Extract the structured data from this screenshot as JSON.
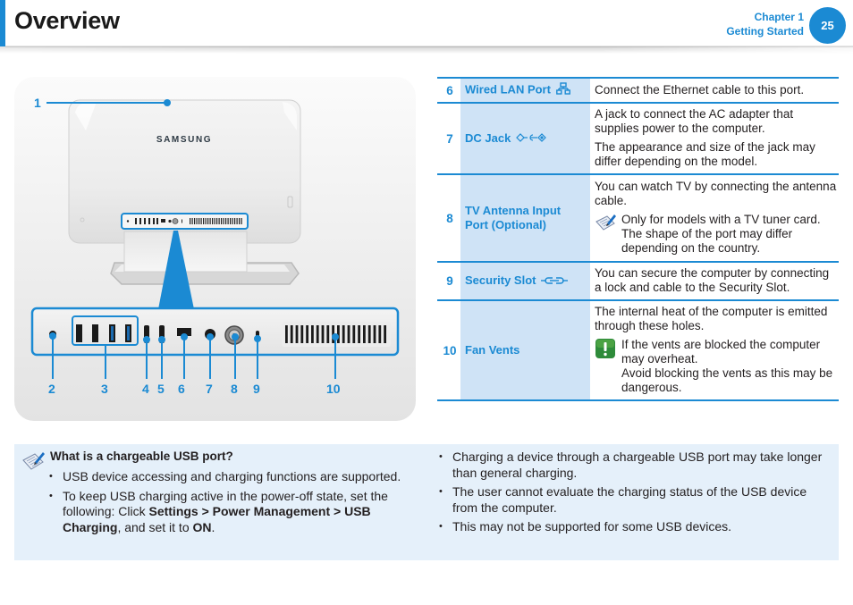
{
  "header": {
    "title": "Overview",
    "chapter_line1": "Chapter 1",
    "chapter_line2": "Getting Started",
    "page_number": "25",
    "accent_color": "#1b8ad3"
  },
  "figure": {
    "brand_text": "SAMSUNG",
    "callouts": [
      "1",
      "2",
      "3",
      "4",
      "5",
      "6",
      "7",
      "8",
      "9",
      "10"
    ]
  },
  "ports_table": {
    "rows": [
      {
        "num": "6",
        "label": "Wired LAN Port",
        "icon": "lan-icon",
        "description": [
          "Connect the Ethernet cable to this port."
        ]
      },
      {
        "num": "7",
        "label": "DC Jack",
        "icon": "dc-jack-icon",
        "description": [
          "A jack to connect the AC adapter that supplies power to the computer.",
          "The appearance and size of the jack may differ depending on the model."
        ]
      },
      {
        "num": "8",
        "label": "TV Antenna Input Port (Optional)",
        "description": [
          "You can watch TV by connecting the antenna cable."
        ],
        "note": {
          "icon": "note-pencil-icon",
          "text": "Only for models with a TV tuner card. The shape of the port may differ depending on the country."
        }
      },
      {
        "num": "9",
        "label": "Security Slot",
        "icon": "security-slot-icon",
        "description": [
          "You can secure the computer by connecting a lock and cable to the Security Slot."
        ]
      },
      {
        "num": "10",
        "label": "Fan Vents",
        "description": [
          "The internal heat of the computer is emitted through these holes."
        ],
        "caution": {
          "icon": "caution-icon",
          "text1": "If the vents are blocked the computer may overheat.",
          "text2": "Avoid blocking the vents as this may be dangerous."
        }
      }
    ]
  },
  "usb_note": {
    "icon": "note-pencil-icon",
    "title": "What is a chargeable USB port?",
    "left_items": [
      "USB device accessing and charging functions are supported.",
      {
        "pre": "To keep USB charging active in the power-off state, set the following: Click ",
        "bold1": "Settings > Power Management > USB Charging",
        "mid": ", and set it to ",
        "bold2": "ON",
        "post": "."
      }
    ],
    "right_items": [
      "Charging a device through a chargeable USB port may take longer than general charging.",
      "The user cannot evaluate the charging status of the USB device from the computer.",
      "This may not be supported for some USB devices."
    ]
  }
}
